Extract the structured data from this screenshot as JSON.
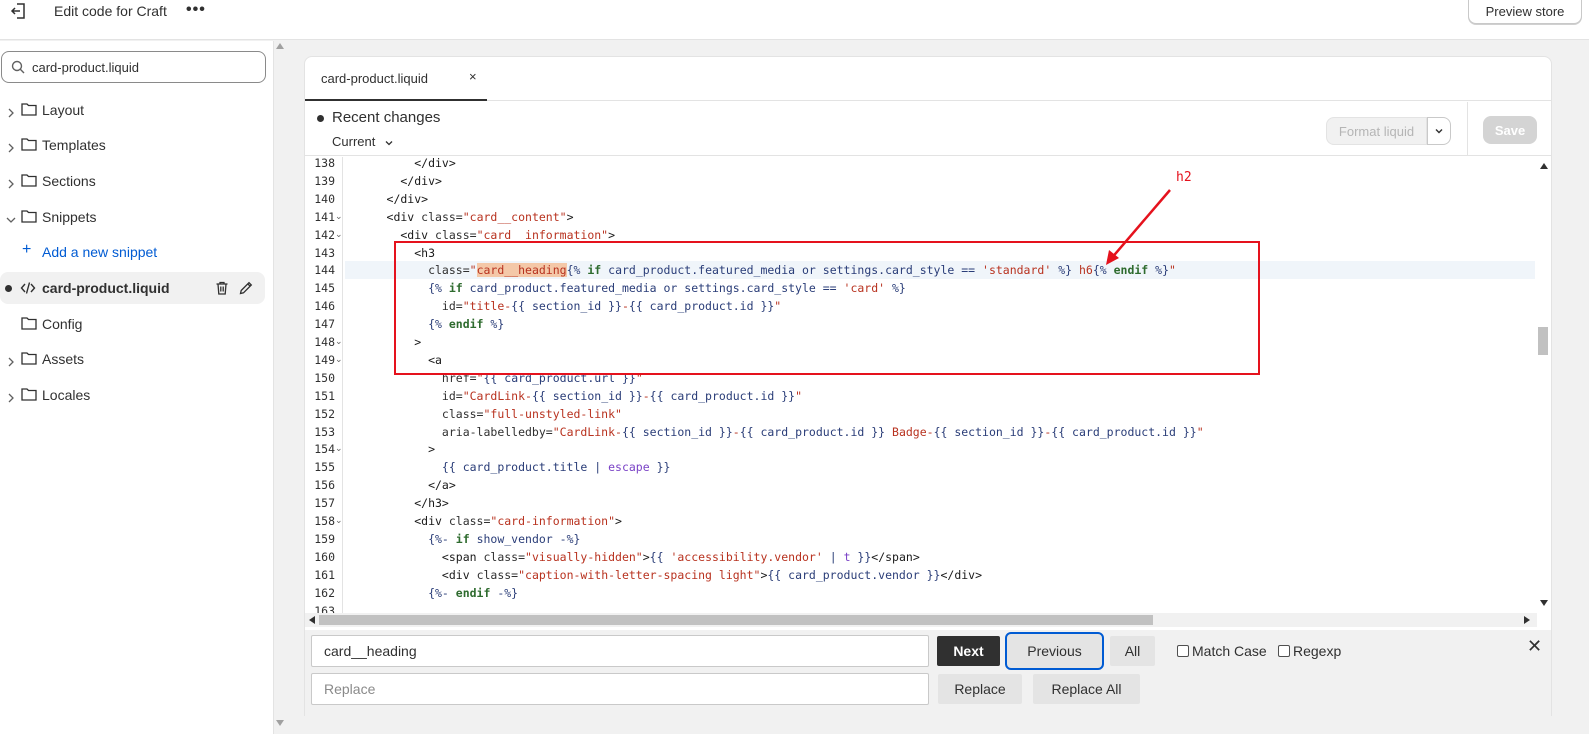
{
  "topbar": {
    "title": "Edit code for Craft",
    "more_label": "•••",
    "preview_label": "Preview store"
  },
  "sidebar": {
    "search_value": "card-product.liquid",
    "folders": [
      {
        "label": "Layout",
        "expanded": false
      },
      {
        "label": "Templates",
        "expanded": false
      },
      {
        "label": "Sections",
        "expanded": false
      },
      {
        "label": "Snippets",
        "expanded": true
      },
      {
        "label": "Config",
        "expanded": false
      },
      {
        "label": "Assets",
        "expanded": false
      },
      {
        "label": "Locales",
        "expanded": false
      }
    ],
    "add_snippet_label": "Add a new snippet",
    "active_file_label": "card-product.liquid"
  },
  "editor": {
    "tab_label": "card-product.liquid",
    "tab_close": "×",
    "changes_title": "Recent changes",
    "version_label": "Current",
    "format_label": "Format liquid",
    "save_label": "Save",
    "lines": [
      {
        "n": "138",
        "fold": ""
      },
      {
        "n": "139",
        "fold": ""
      },
      {
        "n": "140",
        "fold": ""
      },
      {
        "n": "141",
        "fold": "⌄"
      },
      {
        "n": "142",
        "fold": "⌄"
      },
      {
        "n": "143",
        "fold": ""
      },
      {
        "n": "144",
        "fold": ""
      },
      {
        "n": "145",
        "fold": ""
      },
      {
        "n": "146",
        "fold": ""
      },
      {
        "n": "147",
        "fold": ""
      },
      {
        "n": "148",
        "fold": "⌄"
      },
      {
        "n": "149",
        "fold": "⌄"
      },
      {
        "n": "150",
        "fold": ""
      },
      {
        "n": "151",
        "fold": ""
      },
      {
        "n": "152",
        "fold": ""
      },
      {
        "n": "153",
        "fold": ""
      },
      {
        "n": "154",
        "fold": "⌄"
      },
      {
        "n": "155",
        "fold": ""
      },
      {
        "n": "156",
        "fold": ""
      },
      {
        "n": "157",
        "fold": ""
      },
      {
        "n": "158",
        "fold": "⌄"
      },
      {
        "n": "159",
        "fold": ""
      },
      {
        "n": "160",
        "fold": ""
      },
      {
        "n": "161",
        "fold": ""
      },
      {
        "n": "162",
        "fold": ""
      },
      {
        "n": "163",
        "fold": ""
      }
    ],
    "code": [
      [
        {
          "t": "          </div>",
          "c": "tag"
        }
      ],
      [
        {
          "t": "        </div>",
          "c": "tag"
        }
      ],
      [
        {
          "t": "      </div>",
          "c": "tag"
        }
      ],
      [
        {
          "t": "      <div ",
          "c": "tag"
        },
        {
          "t": "class=",
          "c": "attr"
        },
        {
          "t": "\"card__content\"",
          "c": "str"
        },
        {
          "t": ">",
          "c": "tag"
        }
      ],
      [
        {
          "t": "        <div ",
          "c": "tag"
        },
        {
          "t": "class=",
          "c": "attr"
        },
        {
          "t": "\"card__information\"",
          "c": "str"
        },
        {
          "t": ">",
          "c": "tag"
        }
      ],
      [
        {
          "t": "          <h3",
          "c": "tag"
        }
      ],
      [
        {
          "t": "            class=",
          "c": "attr"
        },
        {
          "t": "\"",
          "c": "str"
        },
        {
          "t": "card__heading",
          "c": "hl"
        },
        {
          "t": "{% ",
          "c": "lq"
        },
        {
          "t": "if ",
          "c": "kw"
        },
        {
          "t": "card_product.featured_media or settings.card_style == ",
          "c": "var"
        },
        {
          "t": "'standard'",
          "c": "str"
        },
        {
          "t": " %} ",
          "c": "lq"
        },
        {
          "t": "h6",
          "c": "str"
        },
        {
          "t": "{% ",
          "c": "lq"
        },
        {
          "t": "endif ",
          "c": "kw"
        },
        {
          "t": "%}",
          "c": "lq"
        },
        {
          "t": "\"",
          "c": "str"
        }
      ],
      [
        {
          "t": "            {% ",
          "c": "lq"
        },
        {
          "t": "if ",
          "c": "kw"
        },
        {
          "t": "card_product.featured_media or settings.card_style == ",
          "c": "var"
        },
        {
          "t": "'card'",
          "c": "str"
        },
        {
          "t": " %}",
          "c": "lq"
        }
      ],
      [
        {
          "t": "              id=",
          "c": "attr"
        },
        {
          "t": "\"title-",
          "c": "str"
        },
        {
          "t": "{{ section_id }}",
          "c": "var"
        },
        {
          "t": "-",
          "c": "str"
        },
        {
          "t": "{{ card_product.id }}",
          "c": "var"
        },
        {
          "t": "\"",
          "c": "str"
        }
      ],
      [
        {
          "t": "            {% ",
          "c": "lq"
        },
        {
          "t": "endif ",
          "c": "kw"
        },
        {
          "t": "%}",
          "c": "lq"
        }
      ],
      [
        {
          "t": "          >",
          "c": "tag"
        }
      ],
      [
        {
          "t": "            <a",
          "c": "tag"
        }
      ],
      [
        {
          "t": "              href=",
          "c": "attr"
        },
        {
          "t": "\"",
          "c": "str"
        },
        {
          "t": "{{ card_product.url }}",
          "c": "var"
        },
        {
          "t": "\"",
          "c": "str"
        }
      ],
      [
        {
          "t": "              id=",
          "c": "attr"
        },
        {
          "t": "\"CardLink-",
          "c": "str"
        },
        {
          "t": "{{ section_id }}",
          "c": "var"
        },
        {
          "t": "-",
          "c": "str"
        },
        {
          "t": "{{ card_product.id }}",
          "c": "var"
        },
        {
          "t": "\"",
          "c": "str"
        }
      ],
      [
        {
          "t": "              class=",
          "c": "attr"
        },
        {
          "t": "\"full-unstyled-link\"",
          "c": "str"
        }
      ],
      [
        {
          "t": "              aria-labelledby=",
          "c": "attr"
        },
        {
          "t": "\"CardLink-",
          "c": "str"
        },
        {
          "t": "{{ section_id }}",
          "c": "var"
        },
        {
          "t": "-",
          "c": "str"
        },
        {
          "t": "{{ card_product.id }}",
          "c": "var"
        },
        {
          "t": " Badge-",
          "c": "str"
        },
        {
          "t": "{{ section_id }}",
          "c": "var"
        },
        {
          "t": "-",
          "c": "str"
        },
        {
          "t": "{{ card_product.id }}",
          "c": "var"
        },
        {
          "t": "\"",
          "c": "str"
        }
      ],
      [
        {
          "t": "            >",
          "c": "tag"
        }
      ],
      [
        {
          "t": "              {{ card_product.title | ",
          "c": "var"
        },
        {
          "t": "escape",
          "c": "fn"
        },
        {
          "t": " }}",
          "c": "var"
        }
      ],
      [
        {
          "t": "            </a>",
          "c": "tag"
        }
      ],
      [
        {
          "t": "          </h3>",
          "c": "tag"
        }
      ],
      [
        {
          "t": "          <div ",
          "c": "tag"
        },
        {
          "t": "class=",
          "c": "attr"
        },
        {
          "t": "\"card-information\"",
          "c": "str"
        },
        {
          "t": ">",
          "c": "tag"
        }
      ],
      [
        {
          "t": "            {%- ",
          "c": "lq"
        },
        {
          "t": "if ",
          "c": "kw"
        },
        {
          "t": "show_vendor ",
          "c": "var"
        },
        {
          "t": "-%}",
          "c": "lq"
        }
      ],
      [
        {
          "t": "              <span ",
          "c": "tag"
        },
        {
          "t": "class=",
          "c": "attr"
        },
        {
          "t": "\"visually-hidden\"",
          "c": "str"
        },
        {
          "t": ">",
          "c": "tag"
        },
        {
          "t": "{{ ",
          "c": "var"
        },
        {
          "t": "'accessibility.vendor'",
          "c": "str"
        },
        {
          "t": " | ",
          "c": "var"
        },
        {
          "t": "t",
          "c": "fn"
        },
        {
          "t": " }}",
          "c": "var"
        },
        {
          "t": "</span>",
          "c": "tag"
        }
      ],
      [
        {
          "t": "              <div ",
          "c": "tag"
        },
        {
          "t": "class=",
          "c": "attr"
        },
        {
          "t": "\"caption-with-letter-spacing light\"",
          "c": "str"
        },
        {
          "t": ">",
          "c": "tag"
        },
        {
          "t": "{{ card_product.vendor }}",
          "c": "var"
        },
        {
          "t": "</div>",
          "c": "tag"
        }
      ],
      [
        {
          "t": "            {%- ",
          "c": "lq"
        },
        {
          "t": "endif ",
          "c": "kw"
        },
        {
          "t": "-%}",
          "c": "lq"
        }
      ],
      [
        {
          "t": "",
          "c": "tag"
        }
      ]
    ],
    "active_line_index": 6
  },
  "annotation": {
    "label": "h2",
    "color": "#e5121d"
  },
  "find_replace": {
    "find_value": "card__heading",
    "replace_placeholder": "Replace",
    "next_label": "Next",
    "previous_label": "Previous",
    "all_label": "All",
    "match_case_label": "Match Case",
    "regexp_label": "Regexp",
    "replace_label": "Replace",
    "replace_all_label": "Replace All",
    "close_label": "✕"
  }
}
